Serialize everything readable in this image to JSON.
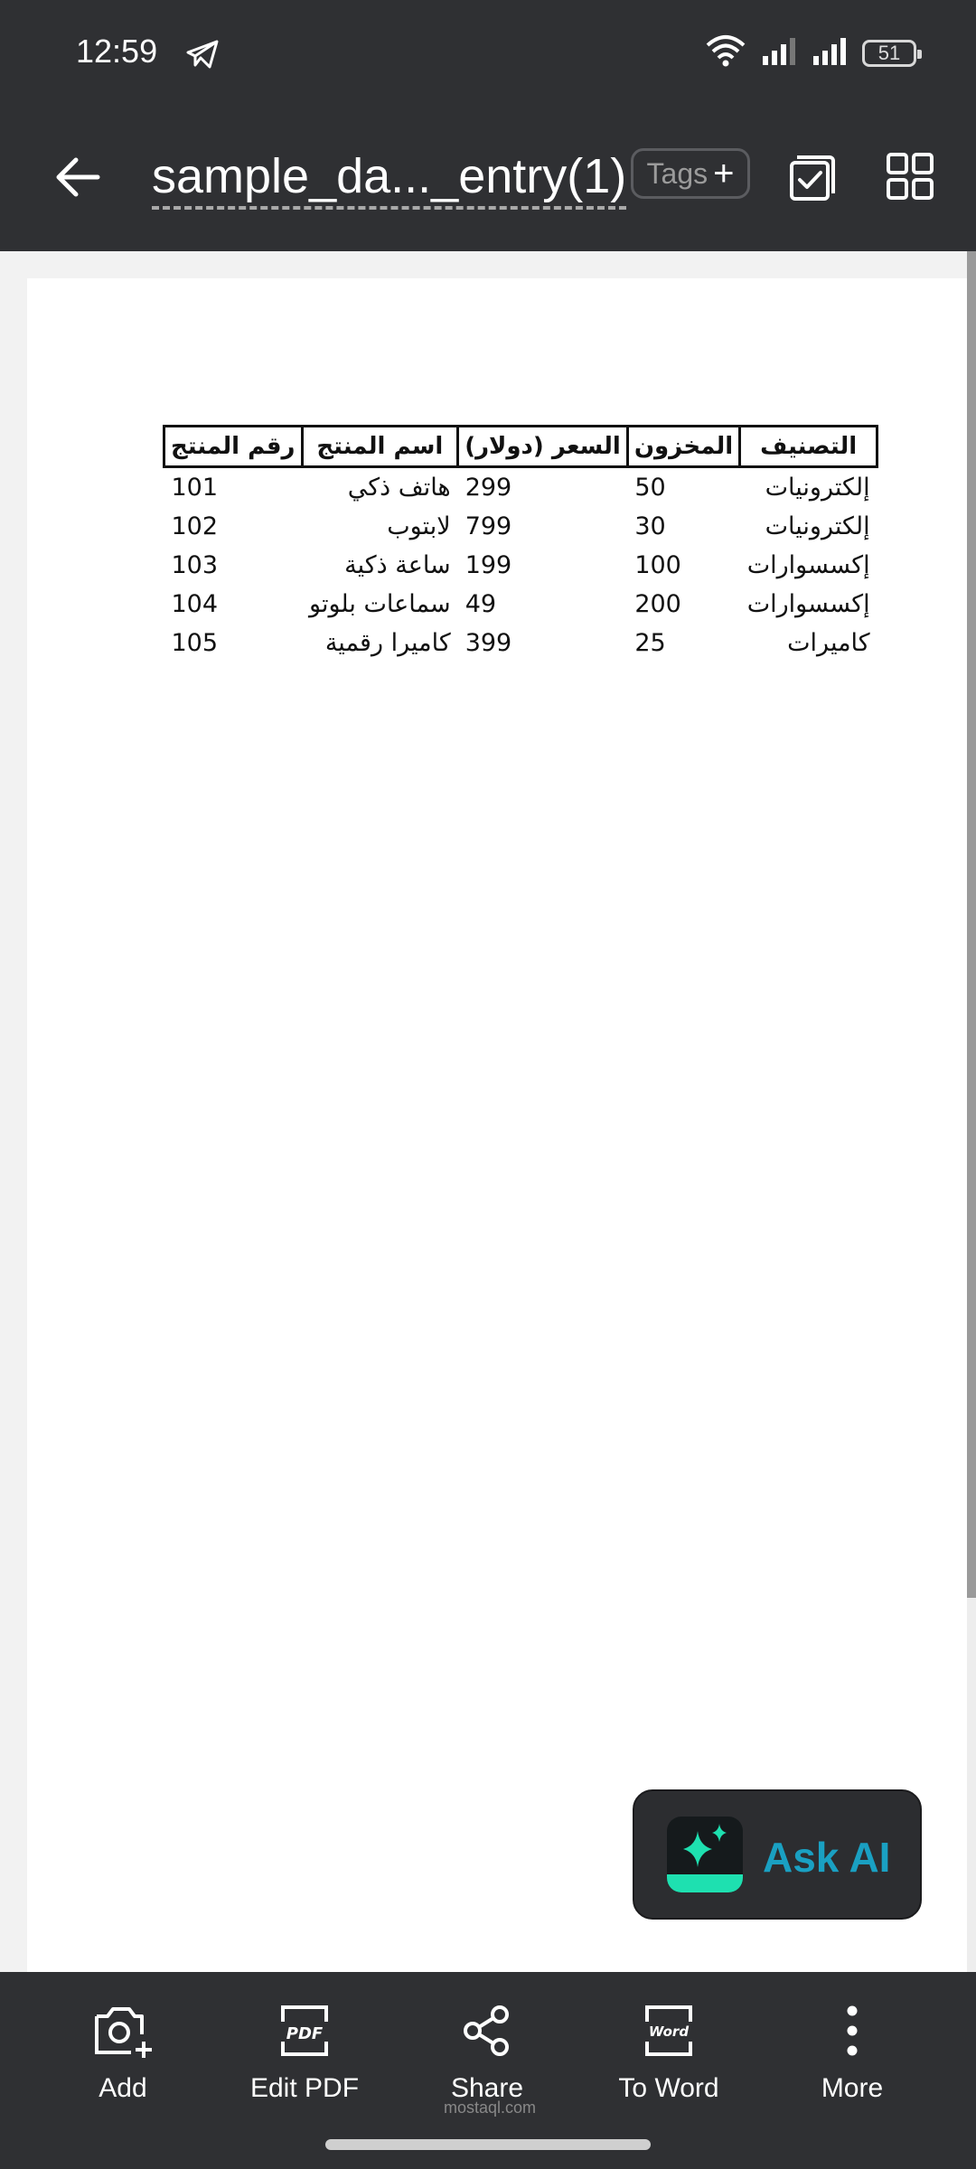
{
  "status_bar": {
    "time": "12:59",
    "battery": "51"
  },
  "app_bar": {
    "title": "sample_da..._entry(1)",
    "tags_label": "Tags"
  },
  "table": {
    "headers": [
      "التصنيف",
      "المخزون",
      "السعر (دولار)",
      "اسم المنتج",
      "رقم المنتج"
    ],
    "rows": [
      {
        "category": "إلكترونيات",
        "stock": "50",
        "price": "299",
        "name": "هاتف ذكي",
        "id": "101"
      },
      {
        "category": "إلكترونيات",
        "stock": "30",
        "price": "799",
        "name": "لابتوب",
        "id": "102"
      },
      {
        "category": "إكسسوارات",
        "stock": "100",
        "price": "199",
        "name": "ساعة ذكية",
        "id": "103"
      },
      {
        "category": "إكسسوارات",
        "stock": "200",
        "price": "49",
        "name": "سماعات بلوتو",
        "id": "104"
      },
      {
        "category": "كاميرات",
        "stock": "25",
        "price": "399",
        "name": "كاميرا رقمية",
        "id": "105"
      }
    ]
  },
  "ask_ai": {
    "label": "Ask AI"
  },
  "bottom_bar": {
    "items": [
      {
        "label": "Add",
        "icon": "add-photo-icon"
      },
      {
        "label": "Edit PDF",
        "icon": "edit-pdf-icon",
        "icon_text": "PDF"
      },
      {
        "label": "Share",
        "icon": "share-icon"
      },
      {
        "label": "To Word",
        "icon": "to-word-icon",
        "icon_text": "Word"
      },
      {
        "label": "More",
        "icon": "more-vertical-icon"
      }
    ]
  },
  "watermark": {
    "text": "mostaql.com"
  },
  "colors": {
    "bar_bg": "#2f3033",
    "ai_accent": "#1aa0c2",
    "ai_green": "#1ee0b0"
  }
}
